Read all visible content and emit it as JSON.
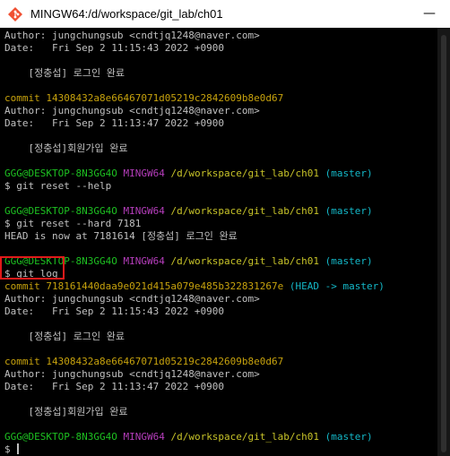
{
  "window": {
    "title": "MINGW64:/d/workspace/git_lab/ch01",
    "minimize_label": "—"
  },
  "terminal": {
    "lines": [
      {
        "text": "Author: jungchungsub <cndtjq1248@naver.com>"
      },
      {
        "text": "Date:   Fri Sep 2 11:15:43 2022 +0900"
      },
      {
        "text": ""
      },
      {
        "text": "    [정충섭] 로그인 완료"
      },
      {
        "text": ""
      },
      {
        "text": "commit 14308432a8e66467071d05219c2842609b8e0d67"
      },
      {
        "text": "Author: jungchungsub <cndtjq1248@naver.com>"
      },
      {
        "text": "Date:   Fri Sep 2 11:13:47 2022 +0900"
      },
      {
        "text": ""
      },
      {
        "text": "    [정충섭]회원가입 완료"
      },
      {
        "text": ""
      },
      {
        "prompt": {
          "user": "GGG@DESKTOP-8N3GG4O",
          "shell": "MINGW64",
          "path": "/d/workspace/git_lab/ch01",
          "branch": "(master)"
        }
      },
      {
        "text": "$ git reset --help"
      },
      {
        "text": ""
      },
      {
        "prompt": {
          "user": "GGG@DESKTOP-8N3GG4O",
          "shell": "MINGW64",
          "path": "/d/workspace/git_lab/ch01",
          "branch": "(master)"
        }
      },
      {
        "text": "$ git reset --hard 7181"
      },
      {
        "text": "HEAD is now at 7181614 [정충섭] 로그인 완료"
      },
      {
        "text": ""
      },
      {
        "prompt": {
          "user": "GGG@DESKTOP-8N3GG4O",
          "shell": "MINGW64",
          "path": "/d/workspace/git_lab/ch01",
          "branch": "(master)"
        }
      },
      {
        "text": "$ git log"
      },
      {
        "commit": {
          "prefix": "commit 718161440daa9e021d415a079e485b322831267e",
          "head": "(HEAD -> master)"
        }
      },
      {
        "text": "Author: jungchungsub <cndtjq1248@naver.com>"
      },
      {
        "text": "Date:   Fri Sep 2 11:15:43 2022 +0900"
      },
      {
        "text": ""
      },
      {
        "text": "    [정충섭] 로그인 완료"
      },
      {
        "text": ""
      },
      {
        "text": "commit 14308432a8e66467071d05219c2842609b8e0d67"
      },
      {
        "text": "Author: jungchungsub <cndtjq1248@naver.com>"
      },
      {
        "text": "Date:   Fri Sep 2 11:13:47 2022 +0900"
      },
      {
        "text": ""
      },
      {
        "text": "    [정충섭]회원가입 완료"
      },
      {
        "text": ""
      },
      {
        "prompt": {
          "user": "GGG@DESKTOP-8N3GG4O",
          "shell": "MINGW64",
          "path": "/d/workspace/git_lab/ch01",
          "branch": "(master)"
        }
      },
      {
        "text": "$ "
      }
    ]
  },
  "colors": {
    "background": "#000000",
    "text": "#c0c0c0",
    "prompt_user": "#1dc121",
    "prompt_shell": "#b53dbb",
    "prompt_path": "#c7c329",
    "prompt_branch": "#14b8c8",
    "commit_hash": "#c7a20d",
    "highlight_box": "#e11a1a"
  },
  "icons": {
    "app": "git-bash-icon"
  }
}
